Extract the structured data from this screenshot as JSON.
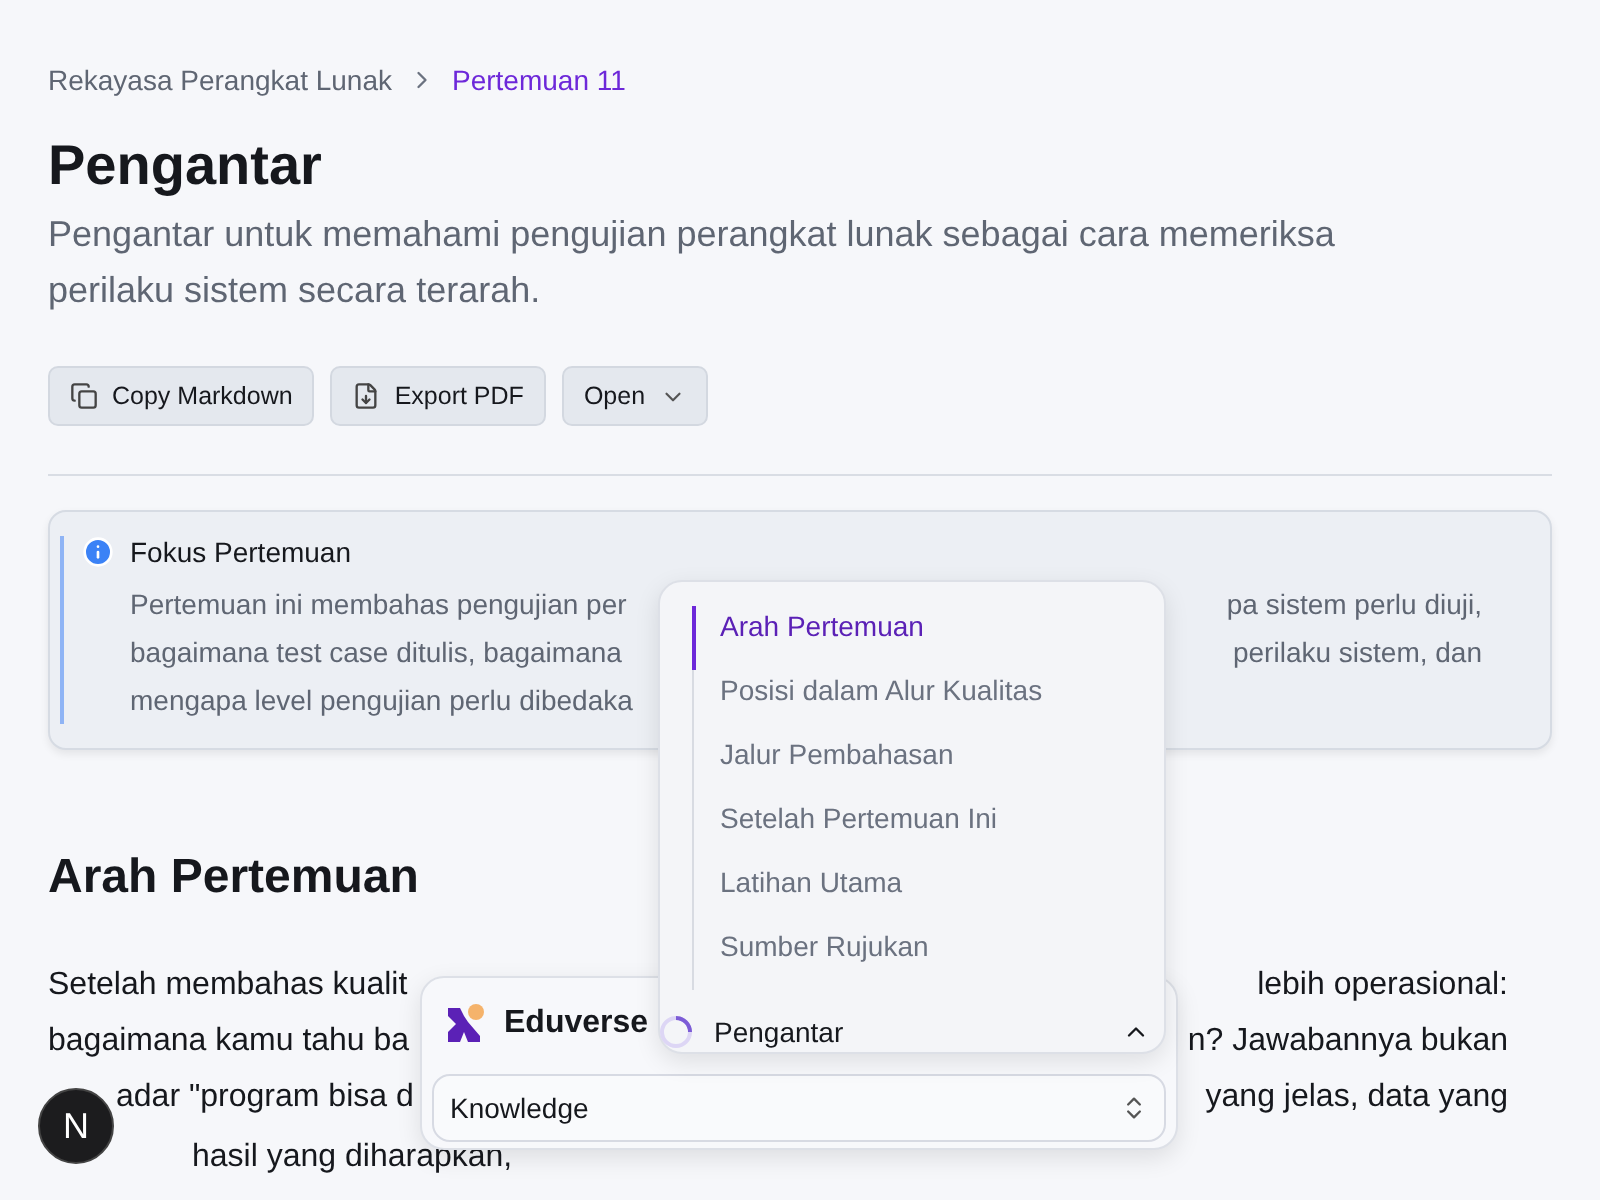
{
  "breadcrumb": [
    {
      "label": "Rekayasa Perangkat Lunak",
      "selected": false
    },
    {
      "label": "Pertemuan 11",
      "selected": true
    }
  ],
  "title": "Pengantar",
  "subtitle": "Pengantar untuk memahami pengujian perangkat lunak sebagai cara memeriksa perilaku sistem secara terarah.",
  "actions": [
    {
      "label": "Copy Markdown",
      "kind": "copy"
    },
    {
      "label": "Export PDF",
      "kind": "pdf"
    },
    {
      "label": "Open",
      "kind": "menu"
    }
  ],
  "callout": {
    "title": "Fokus Pertemuan",
    "lines": [
      {
        "left": "Pertemuan ini membahas pengujian per",
        "right": "pa sistem perlu diuji,"
      },
      {
        "left": "bagaimana test case ditulis, bagaimana",
        "right": "perilaku sistem, dan"
      },
      {
        "left": "mengapa level pengujian perlu dibedaka"
      }
    ]
  },
  "section": {
    "heading": "Arah Pertemuan",
    "lines": [
      {
        "left": "Setelah membahas kualit",
        "right": "lebih operasional:"
      },
      {
        "left": "bagaimana kamu tahu ba",
        "right": "n? Jawabannya bukan"
      },
      {
        "left": "adar \"program bisa d",
        "right": "yang jelas, data yang"
      },
      {
        "left": "hasil yang diharapkan,"
      }
    ]
  },
  "toc": {
    "items": [
      {
        "label": "Arah Pertemuan",
        "selected": true
      },
      {
        "label": "Posisi dalam Alur Kualitas",
        "selected": false
      },
      {
        "label": "Jalur Pembahasan",
        "selected": false
      },
      {
        "label": "Setelah Pertemuan Ini",
        "selected": false
      },
      {
        "label": "Latihan Utama",
        "selected": false
      },
      {
        "label": "Sumber Rujukan",
        "selected": false
      }
    ],
    "current": "Pengantar",
    "expanded": true
  },
  "brand": "Eduverse",
  "selector": {
    "value": "Knowledge"
  },
  "badge": "N"
}
